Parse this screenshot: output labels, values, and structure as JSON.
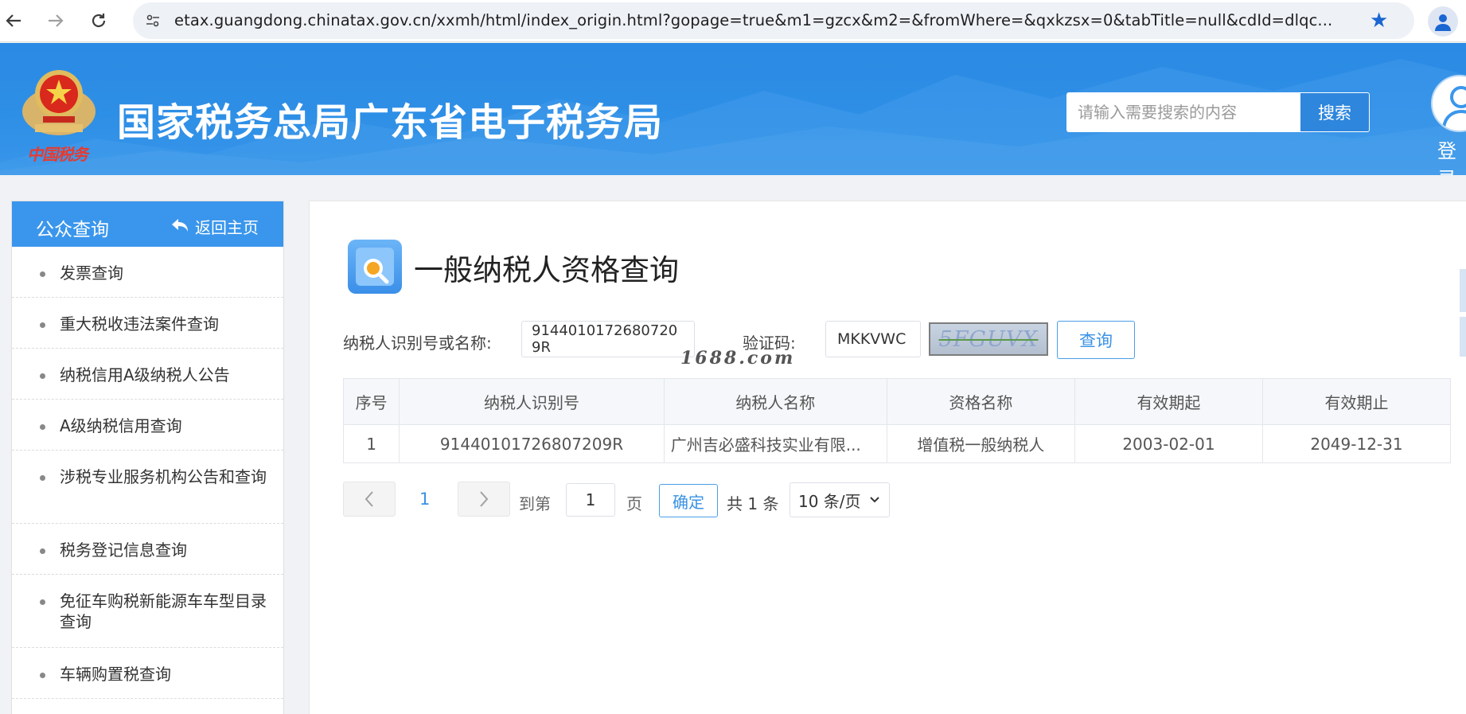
{
  "browser": {
    "url": "etax.guangdong.chinatax.gov.cn/xxmh/html/index_origin.html?gopage=true&m1=gzcx&m2=&fromWhere=&qxkzsx=0&tabTitle=null&cdId=dlqc...",
    "back_icon": "arrow-left-icon",
    "forward_icon": "arrow-right-icon",
    "reload_icon": "reload-icon",
    "bookmark_icon": "star-icon"
  },
  "header": {
    "emblem_caption": "中国税务",
    "title": "国家税务总局广东省电子税务局",
    "search_placeholder": "请输入需要搜索的内容",
    "search_button": "搜索",
    "login_label": "登录"
  },
  "sidebar": {
    "title": "公众查询",
    "back_home": "返回主页",
    "items": [
      {
        "label": "发票查询"
      },
      {
        "label": "重大税收违法案件查询"
      },
      {
        "label": "纳税信用A级纳税人公告"
      },
      {
        "label": "A级纳税信用查询"
      },
      {
        "label": "涉税专业服务机构公告和查询"
      },
      {
        "label": "税务登记信息查询"
      },
      {
        "label": "免征车购税新能源车车型目录查询"
      },
      {
        "label": "车辆购置税查询"
      }
    ]
  },
  "main": {
    "page_title": "一般纳税人资格查询",
    "form": {
      "taxpayer_label": "纳税人识别号或名称:",
      "taxpayer_value": "9144010172680720​9R",
      "captcha_label": "验证码:",
      "captcha_value": "MKKVWC",
      "captcha_image_text": "5FGUVX",
      "query_button": "查询",
      "watermark": "1688.com"
    },
    "table": {
      "columns": [
        "序号",
        "纳税人识别号",
        "纳税人名称",
        "资格名称",
        "有效期起",
        "有效期止"
      ],
      "rows": [
        [
          "1",
          "9144010172680720​9R",
          "广州吉必盛科技实业有限...",
          "增值税一般纳税人",
          "2003-02-01",
          "2049-12-31"
        ]
      ]
    },
    "pager": {
      "current_page": "1",
      "goto_label": "到第",
      "goto_value": "1",
      "page_unit": "页",
      "confirm": "确定",
      "total": "共 1 条",
      "page_size": "10 条/页"
    }
  },
  "colors": {
    "header_blue": "#2e8fe6",
    "sidebar_head": "#3a96ec",
    "link_blue": "#3a92e4"
  }
}
